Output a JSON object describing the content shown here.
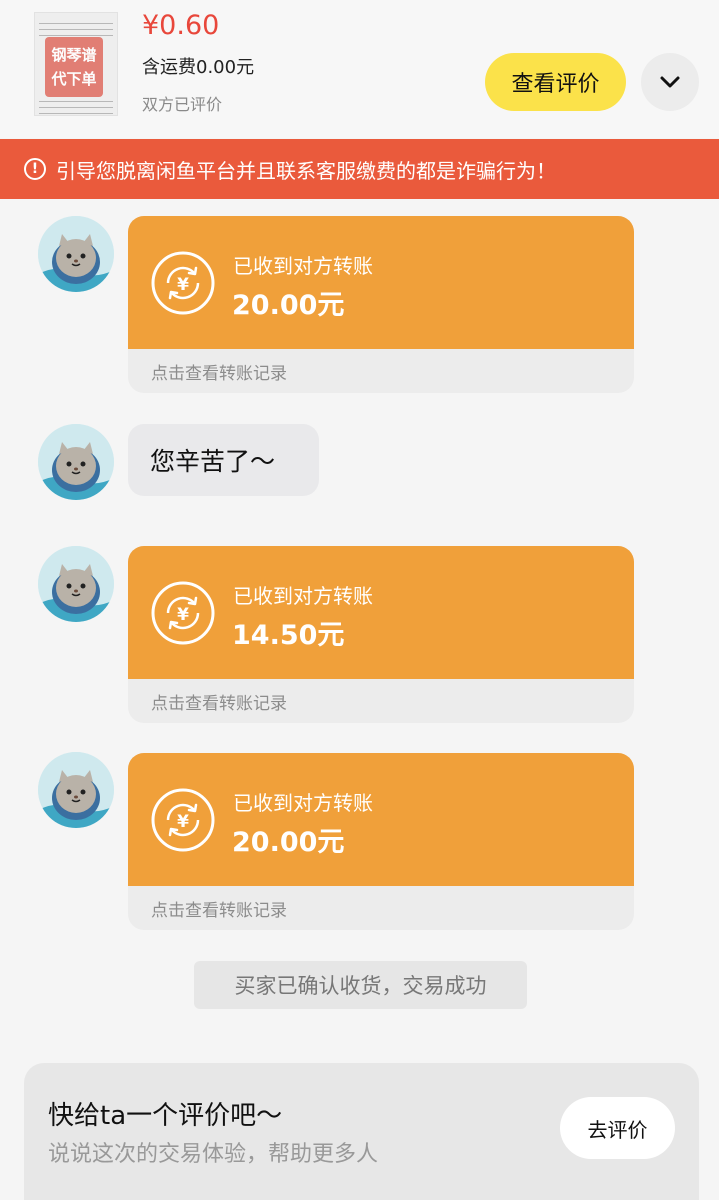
{
  "product": {
    "thumbnail_text": "钢琴谱\n代下单",
    "price": "¥0.60",
    "shipping": "含运费0.00元",
    "rating_status": "双方已评价",
    "view_review_label": "查看评价",
    "expand_icon": "chevron-down-icon"
  },
  "warning": {
    "icon": "exclamation-circle-icon",
    "text": "引导您脱离闲鱼平台并且联系客服缴费的都是诈骗行为！"
  },
  "messages": {
    "transfer1": {
      "label": "已收到对方转账",
      "amount": "20.00元",
      "link": "点击查看转账记录"
    },
    "bubble": {
      "text": "您辛苦了～"
    },
    "transfer2": {
      "label": "已收到对方转账",
      "amount": "14.50元",
      "link": "点击查看转账记录"
    },
    "transfer3": {
      "label": "已收到对方转账",
      "amount": "20.00元",
      "link": "点击查看转账记录"
    }
  },
  "system_message": "买家已确认收货，交易成功",
  "review_prompt": {
    "title": "快给ta一个评价吧～",
    "subtitle": "说说这次的交易体验，帮助更多人",
    "button_label": "去评价"
  },
  "colors": {
    "price": "#e8473b",
    "accent_yellow": "#fbe24a",
    "warning_bg": "#ea5a3c",
    "transfer_orange": "#f0a03a"
  }
}
